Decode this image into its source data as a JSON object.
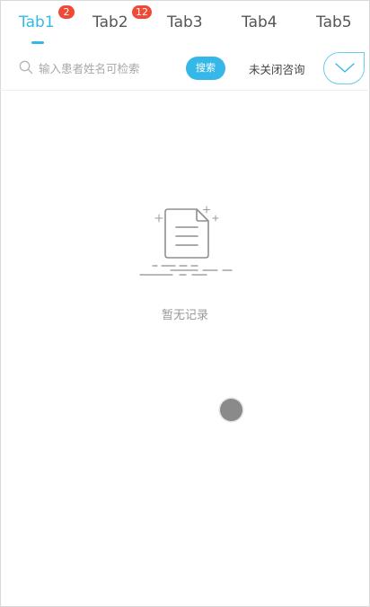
{
  "tabs": [
    {
      "label": "Tab1",
      "badge": "2",
      "active": true
    },
    {
      "label": "Tab2",
      "badge": "12",
      "active": false
    },
    {
      "label": "Tab3",
      "badge": null,
      "active": false
    },
    {
      "label": "Tab4",
      "badge": null,
      "active": false
    },
    {
      "label": "Tab5",
      "badge": null,
      "active": false
    }
  ],
  "search": {
    "placeholder": "输入患者姓名可检索",
    "value": "",
    "button_label": "搜索"
  },
  "filter": {
    "selected_label": "未关闭咨询"
  },
  "empty_state": {
    "message": "暂无记录"
  },
  "colors": {
    "accent": "#35b8e8",
    "badge": "#f04a37",
    "muted_text": "#999999"
  },
  "icons": {
    "search": "search-icon",
    "dropdown": "chevron-down-icon",
    "empty": "empty-document-icon"
  }
}
